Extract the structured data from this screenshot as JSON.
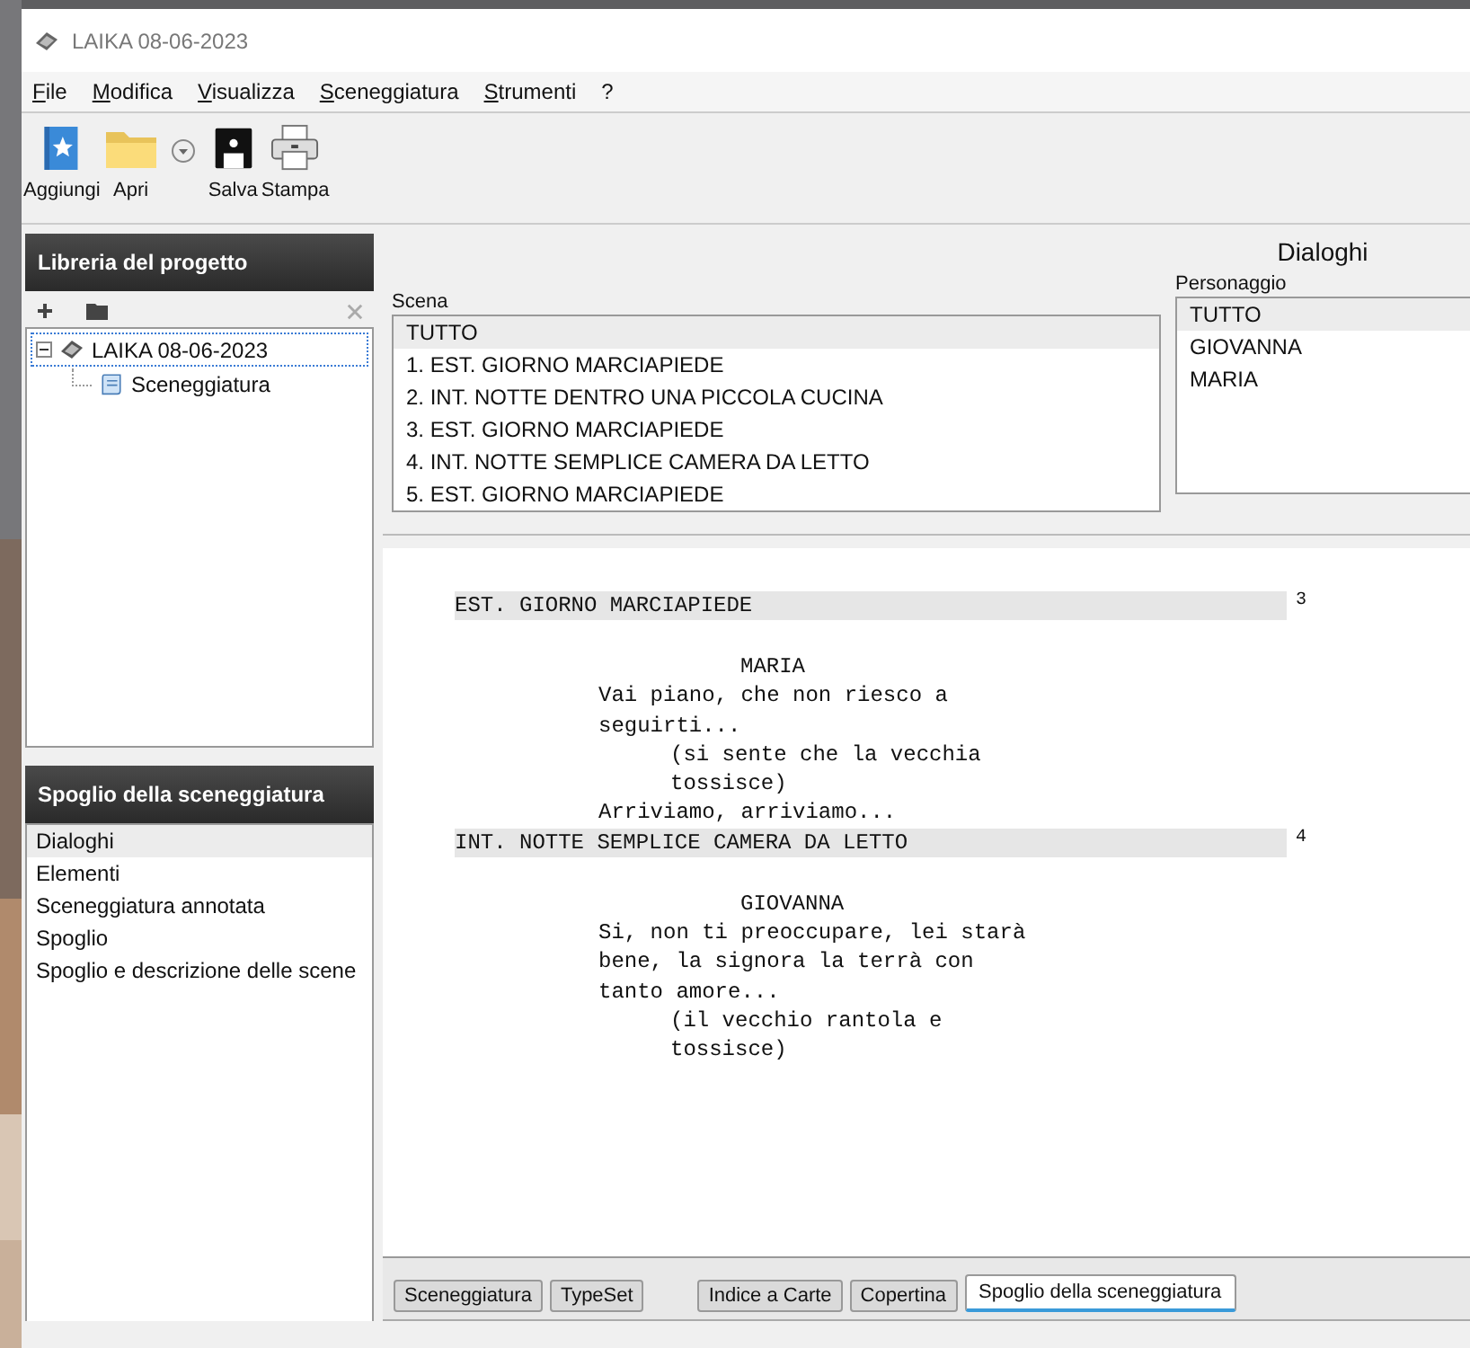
{
  "window": {
    "title": "LAIKA 08-06-2023"
  },
  "menu": [
    "File",
    "Modifica",
    "Visualizza",
    "Sceneggiatura",
    "Strumenti",
    "?"
  ],
  "toolbar": [
    {
      "kind": "add",
      "label": "Aggiungi"
    },
    {
      "kind": "open",
      "label": "Apri"
    },
    {
      "kind": "dropdown"
    },
    {
      "kind": "save",
      "label": "Salva"
    },
    {
      "kind": "print",
      "label": "Stampa"
    }
  ],
  "library": {
    "title": "Libreria del progetto",
    "tree": [
      {
        "label": "LAIKA 08-06-2023",
        "kind": "project",
        "expanded": true,
        "selected": true,
        "children": [
          {
            "label": "Sceneggiatura",
            "kind": "script",
            "selected": false
          }
        ]
      }
    ]
  },
  "breakdown": {
    "title": "Spoglio della sceneggiatura",
    "items": [
      {
        "label": "Dialoghi",
        "selected": true
      },
      {
        "label": "Elementi",
        "selected": false
      },
      {
        "label": "Sceneggiatura annotata",
        "selected": false
      },
      {
        "label": "Spoglio",
        "selected": false
      },
      {
        "label": "Spoglio e descrizione delle scene",
        "selected": false
      }
    ]
  },
  "report_title": "Dialoghi",
  "scenes": {
    "label": "Scena",
    "items": [
      {
        "label": "TUTTO",
        "selected": true
      },
      {
        "label": "1. EST. GIORNO MARCIAPIEDE",
        "selected": false
      },
      {
        "label": "2. INT. NOTTE DENTRO UNA PICCOLA CUCINA",
        "selected": false
      },
      {
        "label": "3. EST. GIORNO MARCIAPIEDE",
        "selected": false
      },
      {
        "label": "4. INT. NOTTE SEMPLICE CAMERA DA LETTO",
        "selected": false
      },
      {
        "label": "5. EST. GIORNO MARCIAPIEDE",
        "selected": false
      }
    ]
  },
  "characters": {
    "label": "Personaggio",
    "items": [
      {
        "label": "TUTTO",
        "selected": true
      },
      {
        "label": "GIOVANNA",
        "selected": false
      },
      {
        "label": "MARIA",
        "selected": false
      }
    ]
  },
  "script": [
    {
      "kind": "heading",
      "text": "EST. GIORNO MARCIAPIEDE",
      "number": "3"
    },
    {
      "kind": "character",
      "lines": [
        "MARIA"
      ]
    },
    {
      "kind": "dialogue",
      "lines": [
        "Vai piano, che non riesco a",
        "seguirti..."
      ]
    },
    {
      "kind": "parenthetical",
      "lines": [
        "(si sente che la vecchia",
        "tossisce)"
      ]
    },
    {
      "kind": "dialogue",
      "lines": [
        "Arriviamo, arriviamo..."
      ]
    },
    {
      "kind": "heading",
      "text": "INT. NOTTE SEMPLICE CAMERA DA LETTO",
      "number": "4"
    },
    {
      "kind": "character",
      "lines": [
        "GIOVANNA"
      ]
    },
    {
      "kind": "dialogue",
      "lines": [
        "Si, non ti preoccupare, lei starà",
        "bene, la signora la terrà con",
        "tanto amore..."
      ]
    },
    {
      "kind": "parenthetical",
      "lines": [
        "(il vecchio rantola e",
        "tossisce)"
      ]
    }
  ],
  "tabs": [
    {
      "label": "Sceneggiatura",
      "selected": false
    },
    {
      "label": "TypeSet",
      "selected": false
    },
    {
      "label": "Indice a Carte",
      "selected": false
    },
    {
      "label": "Copertina",
      "selected": false
    },
    {
      "label": "Spoglio della sceneggiatura",
      "selected": true
    }
  ]
}
